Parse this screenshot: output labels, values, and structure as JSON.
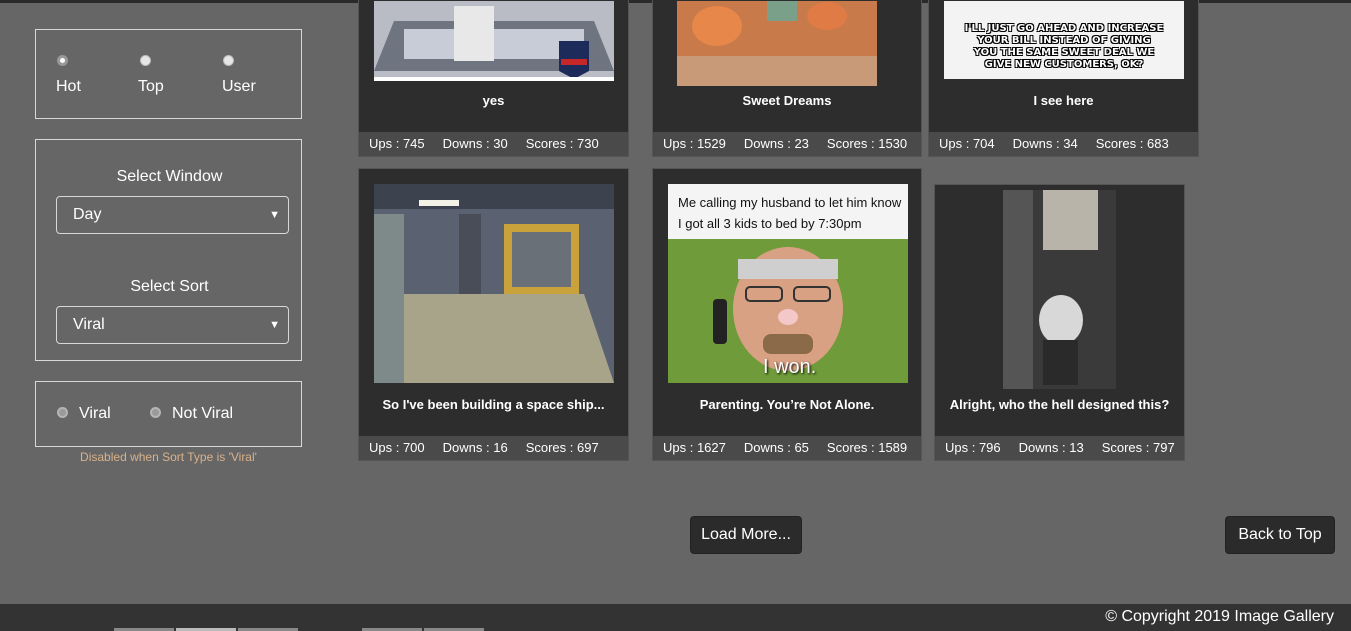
{
  "mode_radios": [
    {
      "label": "Hot",
      "checked": true
    },
    {
      "label": "Top",
      "checked": false
    },
    {
      "label": "User",
      "checked": false
    }
  ],
  "window": {
    "caption": "Select Window",
    "value": "Day"
  },
  "sort": {
    "caption": "Select Sort",
    "value": "Viral"
  },
  "viral_radios": [
    {
      "label": "Viral"
    },
    {
      "label": "Not Viral"
    }
  ],
  "viral_note": "Disabled when Sort Type is 'Viral'",
  "cards": [
    {
      "title": "yes",
      "ups": "Ups : 745",
      "downs": "Downs : 30",
      "scores": "Scores : 730",
      "image": "motorcycle-stunt-image"
    },
    {
      "title": "Sweet Dreams",
      "ups": "Ups : 1529",
      "downs": "Downs : 23",
      "scores": "Scores : 1530",
      "image": "cartoon-side-effects-image"
    },
    {
      "title": "I see here",
      "ups": "Ups : 704",
      "downs": "Downs : 34",
      "scores": "Scores : 683",
      "image": "meme-caption-image",
      "image_text": "I'LL JUST GO AHEAD AND INCREASE YOUR BILL INSTEAD OF GIVING YOU THE SAME SWEET DEAL WE GIVE NEW CUSTOMERS, OK?"
    },
    {
      "title": "So I've been building a space ship...",
      "ups": "Ups : 700",
      "downs": "Downs : 16",
      "scores": "Scores : 697",
      "image": "space-ship-interior-image"
    },
    {
      "title": "Parenting. You’re Not Alone.",
      "ups": "Ups : 1627",
      "downs": "Downs : 65",
      "scores": "Scores : 1589",
      "image": "man-on-phone-image",
      "image_text_top": "Me calling my husband to let him know I got all 3 kids to bed by 7:30pm",
      "image_text_bottom": "I won."
    },
    {
      "title": "Alright, who the hell designed this?",
      "ups": "Ups : 796",
      "downs": "Downs : 13",
      "scores": "Scores : 797",
      "image": "bathroom-dryer-image"
    }
  ],
  "load_more_label": "Load More...",
  "back_to_top_label": "Back to Top",
  "copyright": "© Copyright 2019 Image Gallery",
  "colors": {
    "background": "#666666",
    "card": "#2d2d2d",
    "note": "#d9b28a"
  }
}
